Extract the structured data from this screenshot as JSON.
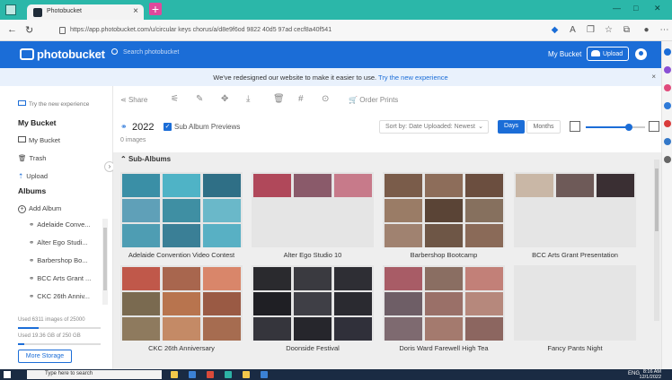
{
  "browser": {
    "tab_title": "Photobucket",
    "url": "https://app.photobucket.com/u/circular keys chorus/a/d8e9f6od 9822 40d5 97ad cecf8a40f541",
    "reader_label": "A",
    "window_controls": [
      "—",
      "□",
      "✕"
    ]
  },
  "site": {
    "logo_text": "photobucket",
    "search_placeholder": "Search photobucket",
    "my_bucket": "My Bucket",
    "upload": "Upload"
  },
  "banner": {
    "text": "We've redesigned our website to make it easier to use.",
    "link": "Try the new experience",
    "close": "×"
  },
  "sidebar": {
    "try_new": "Try the new experience",
    "my_bucket_head": "My Bucket",
    "my_bucket": "My Bucket",
    "trash": "Trash",
    "upload": "Upload",
    "albums_head": "Albums",
    "add_album": "Add Album",
    "albums": [
      "Adelaide Conve...",
      "Alter Ego Studi...",
      "Barbershop Bo...",
      "BCC Arts Grant ...",
      "CKC 26th Anniv..."
    ],
    "collapse_icon": "chevron-right",
    "images_usage": "Used 6311 images of 25000",
    "images_fraction": 0.2524,
    "storage_usage": "Used 19.36 GB of 250 GB",
    "storage_fraction": 0.0774,
    "more_storage": "More Storage"
  },
  "toolbar": {
    "share": "Share",
    "order_prints": "Order Prints"
  },
  "album": {
    "year": "2022",
    "sub_album_previews": "Sub Album Previews",
    "image_count": "0 images",
    "sort": "Sort by: Date Uploaded: Newest",
    "days": "Days",
    "months": "Months",
    "zoom_fraction": 0.72
  },
  "gallery": {
    "subhead": "Sub-Albums",
    "cards": [
      {
        "name": "Adelaide Convention Video Contest",
        "palette": [
          "#3a8fa6",
          "#4fb3c6",
          "#2f6f86",
          "#5fa0b8",
          "#3f8fa3",
          "#6ab8c9",
          "#4e9db3",
          "#3a7f96",
          "#58b0c4"
        ]
      },
      {
        "name": "Alter Ego Studio 10",
        "palette": [
          "#b0485a",
          "#8a5a6a",
          "#c77a8a",
          "#e5e5e5",
          "#e5e5e5",
          "#e5e5e5",
          "#e5e5e5",
          "#e5e5e5",
          "#e5e5e5"
        ]
      },
      {
        "name": "Barbershop Bootcamp",
        "palette": [
          "#7a5c4a",
          "#8d6d5a",
          "#6b4e3f",
          "#9a7c66",
          "#5a4436",
          "#86705e",
          "#a08270",
          "#6e5646",
          "#8a6a58"
        ]
      },
      {
        "name": "BCC Arts Grant Presentation",
        "palette": [
          "#c9b7a6",
          "#6e5a58",
          "#3a2f33",
          "#e5e5e5",
          "#e5e5e5",
          "#e5e5e5",
          "#e5e5e5",
          "#e5e5e5",
          "#e5e5e5"
        ]
      },
      {
        "name": "CKC 26th Anniversary",
        "palette": [
          "#c0584a",
          "#a8664e",
          "#d9866a",
          "#7a6a50",
          "#b8744e",
          "#9a5a44",
          "#8e7a5e",
          "#c48a66",
          "#a66c50"
        ]
      },
      {
        "name": "Doonside Festival",
        "palette": [
          "#2a2a2e",
          "#3a3a40",
          "#2e2e34",
          "#1f1f24",
          "#3f3f46",
          "#2a2a30",
          "#35353c",
          "#26262c",
          "#30303a"
        ]
      },
      {
        "name": "Doris Ward Farewell High Tea",
        "palette": [
          "#a85c66",
          "#8a6e62",
          "#c28078",
          "#6e5e66",
          "#9a7068",
          "#b6887c",
          "#7e6a70",
          "#a47a6e",
          "#8c6660"
        ]
      },
      {
        "name": "Fancy Pants Night",
        "palette": [
          "#e5e5e5",
          "#e5e5e5",
          "#e5e5e5",
          "#e5e5e5",
          "#e5e5e5",
          "#e5e5e5",
          "#e5e5e5",
          "#e5e5e5",
          "#e5e5e5"
        ]
      }
    ]
  },
  "taskbar": {
    "search": "Type here to search",
    "lang": "ENG",
    "time": "8:16 AM",
    "date": "12/1/2022"
  },
  "colors": {
    "brand": "#1b6dd7",
    "tabstrip": "#2bb7a9",
    "taskbar": "#1a2b43"
  }
}
